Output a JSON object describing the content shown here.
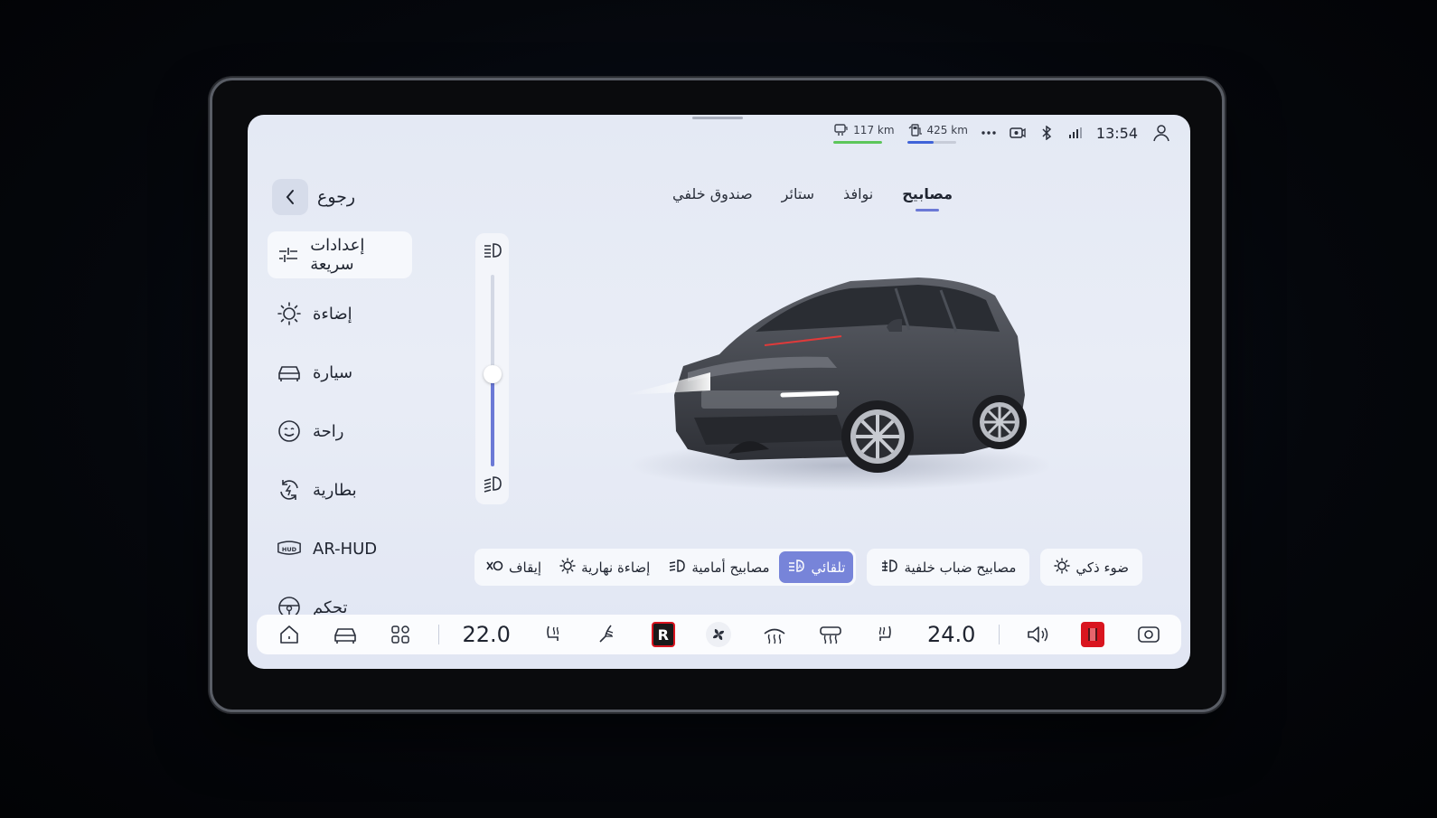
{
  "status": {
    "range_1": "117 km",
    "range_1_fill": 1.0,
    "range_1_color": "#5cc65a",
    "range_2": "425 km",
    "range_2_fill": 0.55,
    "range_2_color": "#3f63d8",
    "time": "13:54"
  },
  "back": {
    "label": "رجوع"
  },
  "tabs": [
    {
      "label": "مصابيح",
      "active": true
    },
    {
      "label": "نوافذ"
    },
    {
      "label": "ستائر"
    },
    {
      "label": "صندوق خلفي"
    }
  ],
  "sidebar": {
    "items": [
      {
        "label": "إعدادات سريعة",
        "icon": "sliders-icon",
        "active": true
      },
      {
        "label": "إضاءة",
        "icon": "sun-icon"
      },
      {
        "label": "سيارة",
        "icon": "car-icon"
      },
      {
        "label": "راحة",
        "icon": "smile-icon"
      },
      {
        "label": "بطارية",
        "icon": "battery-cycle-icon"
      },
      {
        "label": "AR-HUD",
        "icon": "hud-icon"
      },
      {
        "label": "تحكم",
        "icon": "steering-wheel-icon"
      }
    ]
  },
  "headlight_level": {
    "value_fraction": 0.48
  },
  "lights": {
    "main_group": [
      {
        "label": "إيقاف",
        "icon": "off-icon"
      },
      {
        "label": "إضاءة نهارية",
        "icon": "daylight-icon"
      },
      {
        "label": "مصابيح أمامية",
        "icon": "headlight-icon"
      },
      {
        "label": "تلقائي",
        "icon": "auto-headlight-icon",
        "active": true
      }
    ],
    "fog": {
      "label": "مصابيح ضباب خلفية",
      "icon": "rear-fog-icon"
    },
    "smart": {
      "label": "ضوء ذكي",
      "icon": "smart-light-icon"
    }
  },
  "dock": {
    "driver_temp": "22.0",
    "passenger_temp": "24.0",
    "accent": "#6b79d6",
    "app_tile_color": "#d9151f"
  }
}
